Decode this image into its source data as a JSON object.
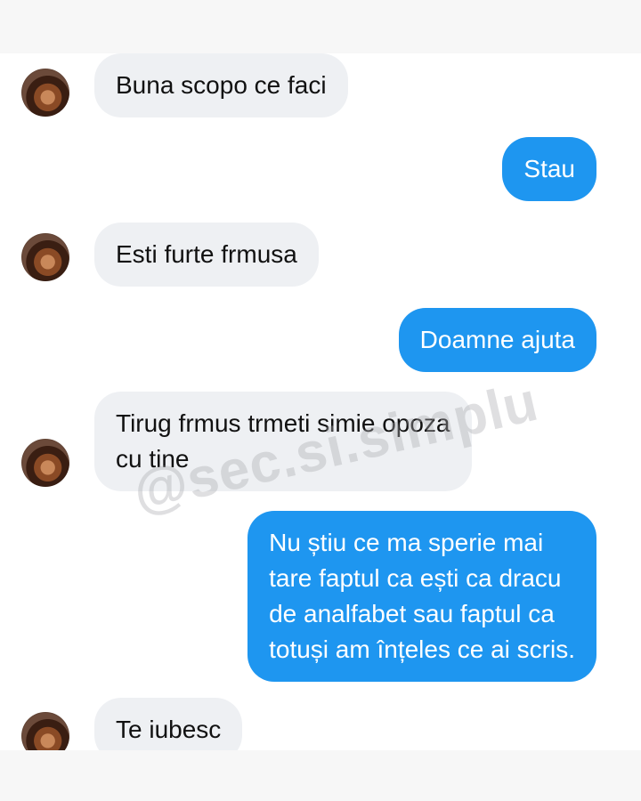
{
  "messages": [
    {
      "side": "received",
      "text": "Buna scopo ce faci"
    },
    {
      "side": "sent",
      "text": "Stau"
    },
    {
      "side": "received",
      "text": "Esti furte frmusa"
    },
    {
      "side": "sent",
      "text": "Doamne ajuta"
    },
    {
      "side": "received",
      "lines": [
        "Tirug frmus trmeti simie opoza",
        "cu tine"
      ]
    },
    {
      "side": "sent",
      "lines": [
        "Nu știu ce ma sperie mai",
        "tare faptul ca ești ca dracu",
        "de analfabet sau faptul ca",
        "totuși am înțeles ce ai scris."
      ]
    },
    {
      "side": "received",
      "text": "Te iubesc"
    }
  ],
  "watermark": "@sec.si.simplu",
  "colors": {
    "sent_bubble": "#1e96f0",
    "received_bubble": "#eef0f3",
    "sent_text": "#ffffff",
    "received_text": "#111111"
  },
  "icons": {
    "avatar": "contact-avatar-photo"
  }
}
